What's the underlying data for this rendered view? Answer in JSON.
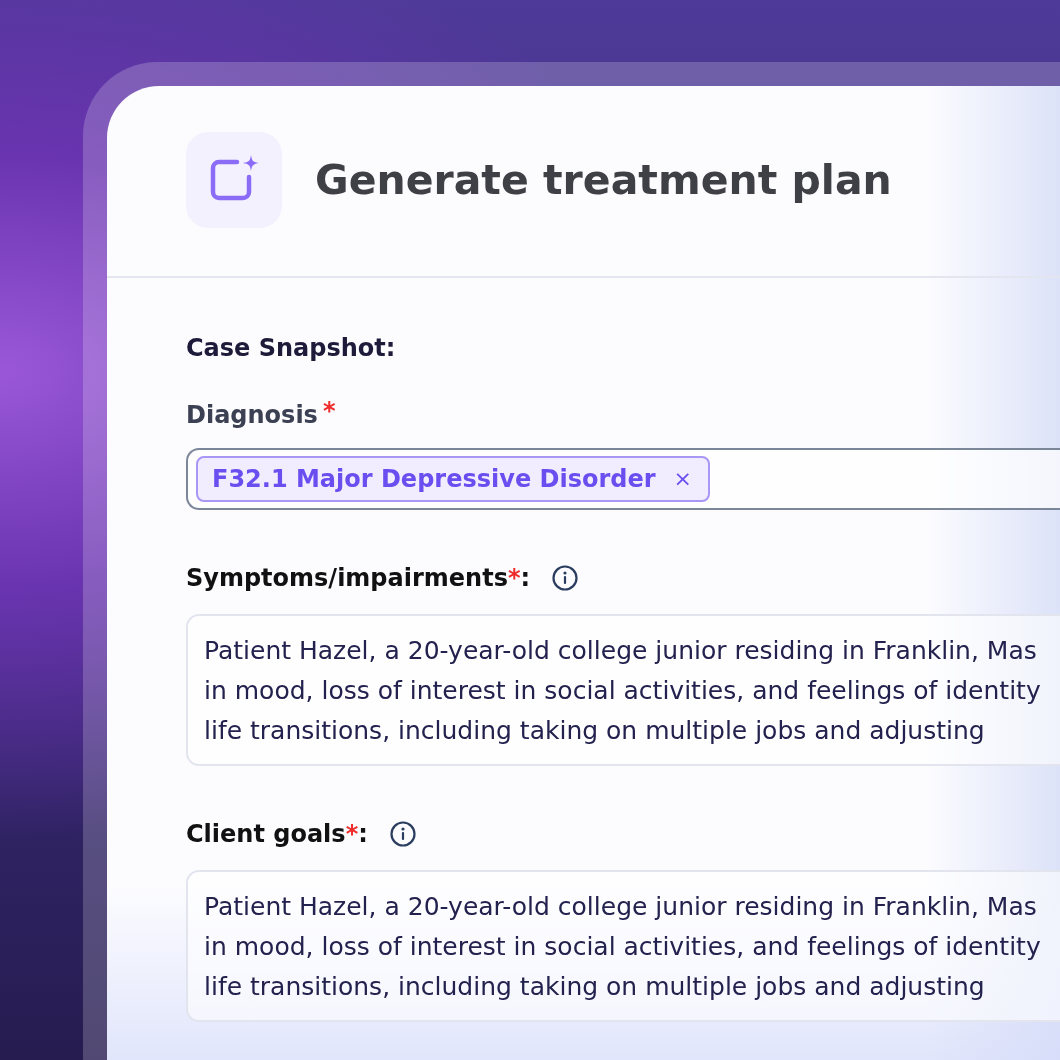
{
  "header": {
    "title": "Generate treatment plan"
  },
  "form": {
    "section_title": "Case Snapshot:",
    "fields": [
      {
        "kind": "tags",
        "label": "Diagnosis",
        "required_mark": "*",
        "info": false,
        "tags": [
          {
            "label": "F32.1 Major Depressive Disorder",
            "remove": "×"
          }
        ]
      },
      {
        "kind": "text",
        "label": "Symptoms/impairments",
        "required_mark": "*",
        "suffix": ":",
        "info": true,
        "lines": [
          "Patient Hazel, a 20-year-old college junior residing in Franklin, Mas",
          "in mood, loss of interest in social activities, and feelings of identity",
          "life transitions, including taking on multiple jobs and adjusting"
        ]
      },
      {
        "kind": "text",
        "label": "Client goals",
        "required_mark": "*",
        "suffix": ":",
        "info": true,
        "lines": [
          "Patient Hazel, a 20-year-old college junior residing in Franklin, Mas",
          "in mood, loss of interest in social activities, and feelings of identity",
          "life transitions, including taking on multiple jobs and adjusting"
        ]
      }
    ]
  }
}
